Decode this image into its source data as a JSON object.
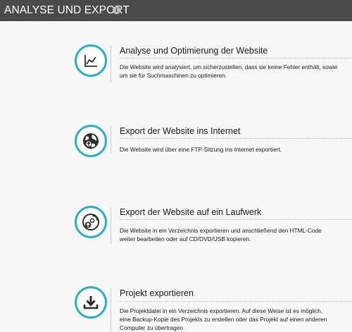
{
  "header": {
    "title": "ANALYSE UND EXPORT",
    "info_glyph": "i"
  },
  "items": [
    {
      "icon": "chart-line-icon",
      "title": "Analyse und Optimierung der Website",
      "desc_lines": [
        "Die Website wird analysiert, um sicherzustellen, dass sie keine Fehler enthält, sowie",
        "um sie für Suchmaschinen zu optimieren."
      ]
    },
    {
      "icon": "globe-upload-icon",
      "title": "Export der Website ins Internet",
      "desc_lines": [
        "Die Website wird über eine FTP-Sitzung ins Internet exportiert."
      ]
    },
    {
      "icon": "disc-upload-icon",
      "title": "Export der Website auf ein Laufwerk",
      "desc_lines": [
        "Die Website in ein Verzeichnis exportieren und  anschließend den HTML-Code",
        "weiter bearbeiten oder auf CD/DVD/USB kopieren."
      ]
    },
    {
      "icon": "download-icon",
      "title": "Projekt exportieren",
      "desc_lines": [
        "Die Projektdatei in ein Verzeichnis exportieren. Auf diese Weise ist es möglich,",
        "eine Backup-Kopie des Projekts zu erstellen oder das Projekt auf einen anderen",
        "Computer zu übertragen."
      ]
    }
  ],
  "colors": {
    "accent": "#2ab0c6",
    "header_bg": "#4a4a4a",
    "icon_dark": "#2b2b2b"
  }
}
